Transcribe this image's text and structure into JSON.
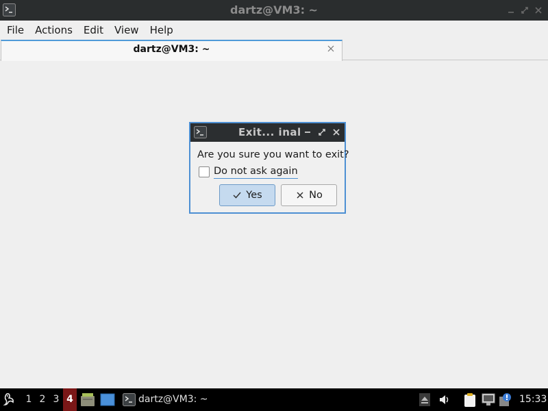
{
  "window": {
    "title": "dartz@VM3: ~"
  },
  "menu": {
    "items": [
      "File",
      "Actions",
      "Edit",
      "View",
      "Help"
    ]
  },
  "tabs": [
    {
      "label": "dartz@VM3: ~",
      "active": true
    }
  ],
  "dialog": {
    "title": "Exit... inal",
    "question": "Are you sure you want to exit?",
    "checkbox_label": "Do not ask again",
    "checkbox_checked": false,
    "yes_label": "Yes",
    "no_label": "No"
  },
  "taskbar": {
    "workspaces": [
      "1",
      "2",
      "3",
      "4"
    ],
    "active_workspace": "4",
    "task_label": "dartz@VM3: ~",
    "clock": "15:33"
  },
  "colors": {
    "accent": "#4c8fd3",
    "titlebar": "#2a2d2e",
    "active_workspace": "#7a1717"
  }
}
